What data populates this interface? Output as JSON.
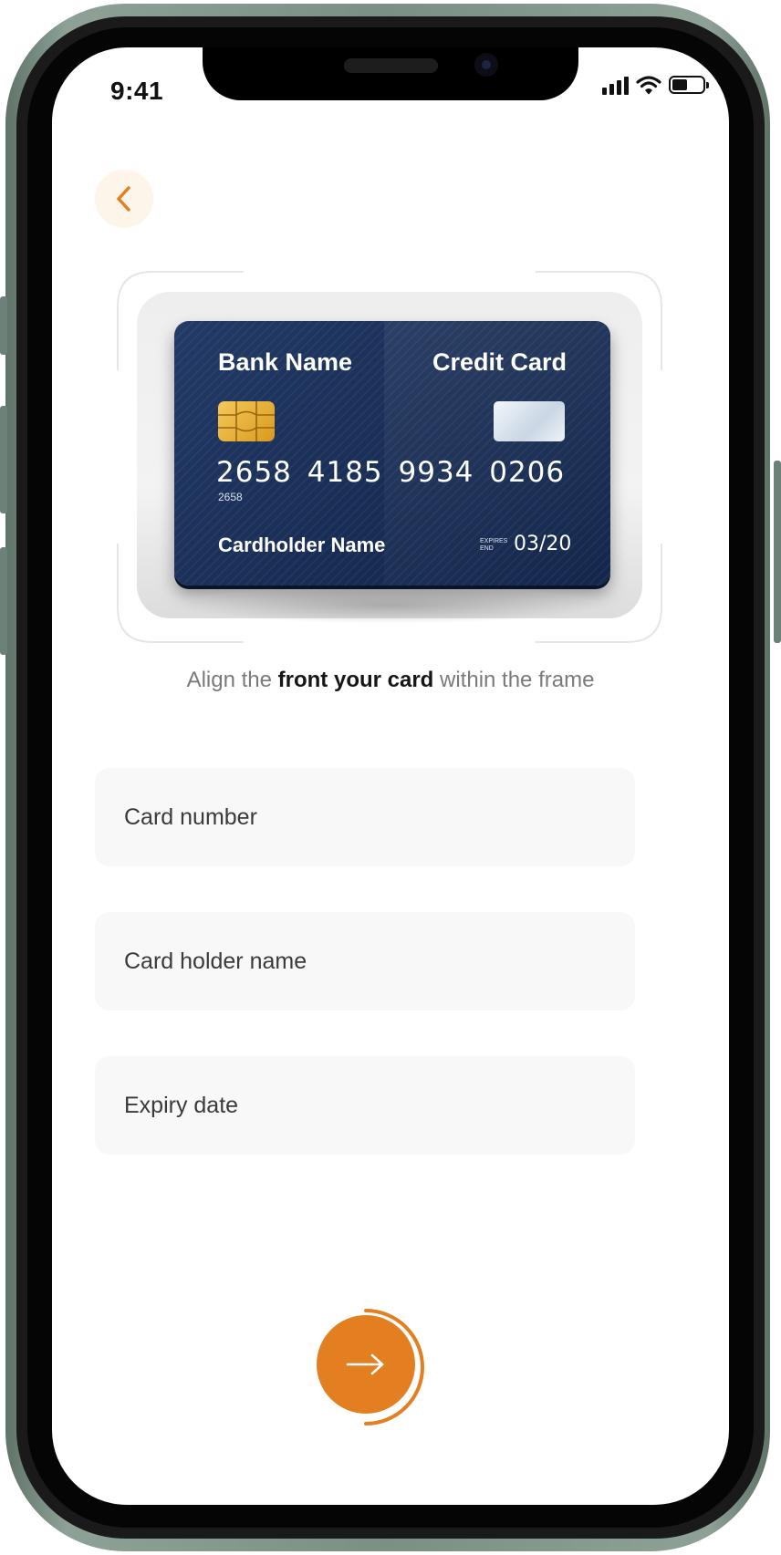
{
  "status_bar": {
    "time": "9:41"
  },
  "card_preview": {
    "bank_name": "Bank Name",
    "card_type": "Credit Card",
    "number": "2658 4185 9934 0206",
    "number_small": "2658",
    "holder": "Cardholder Name",
    "expires_label": "EXPIRES END",
    "expiry": "03/20"
  },
  "instruction": {
    "prefix": "Align the ",
    "bold": "front your card",
    "suffix": " within the frame"
  },
  "form": {
    "card_number_placeholder": "Card number",
    "holder_name_placeholder": "Card holder name",
    "expiry_placeholder": "Expiry date"
  },
  "colors": {
    "accent": "#e37f21",
    "card_blue": "#1a2f57",
    "field_bg": "#f8f8f8"
  },
  "icons": {
    "back": "chevron-left-icon",
    "next": "arrow-right-icon"
  }
}
